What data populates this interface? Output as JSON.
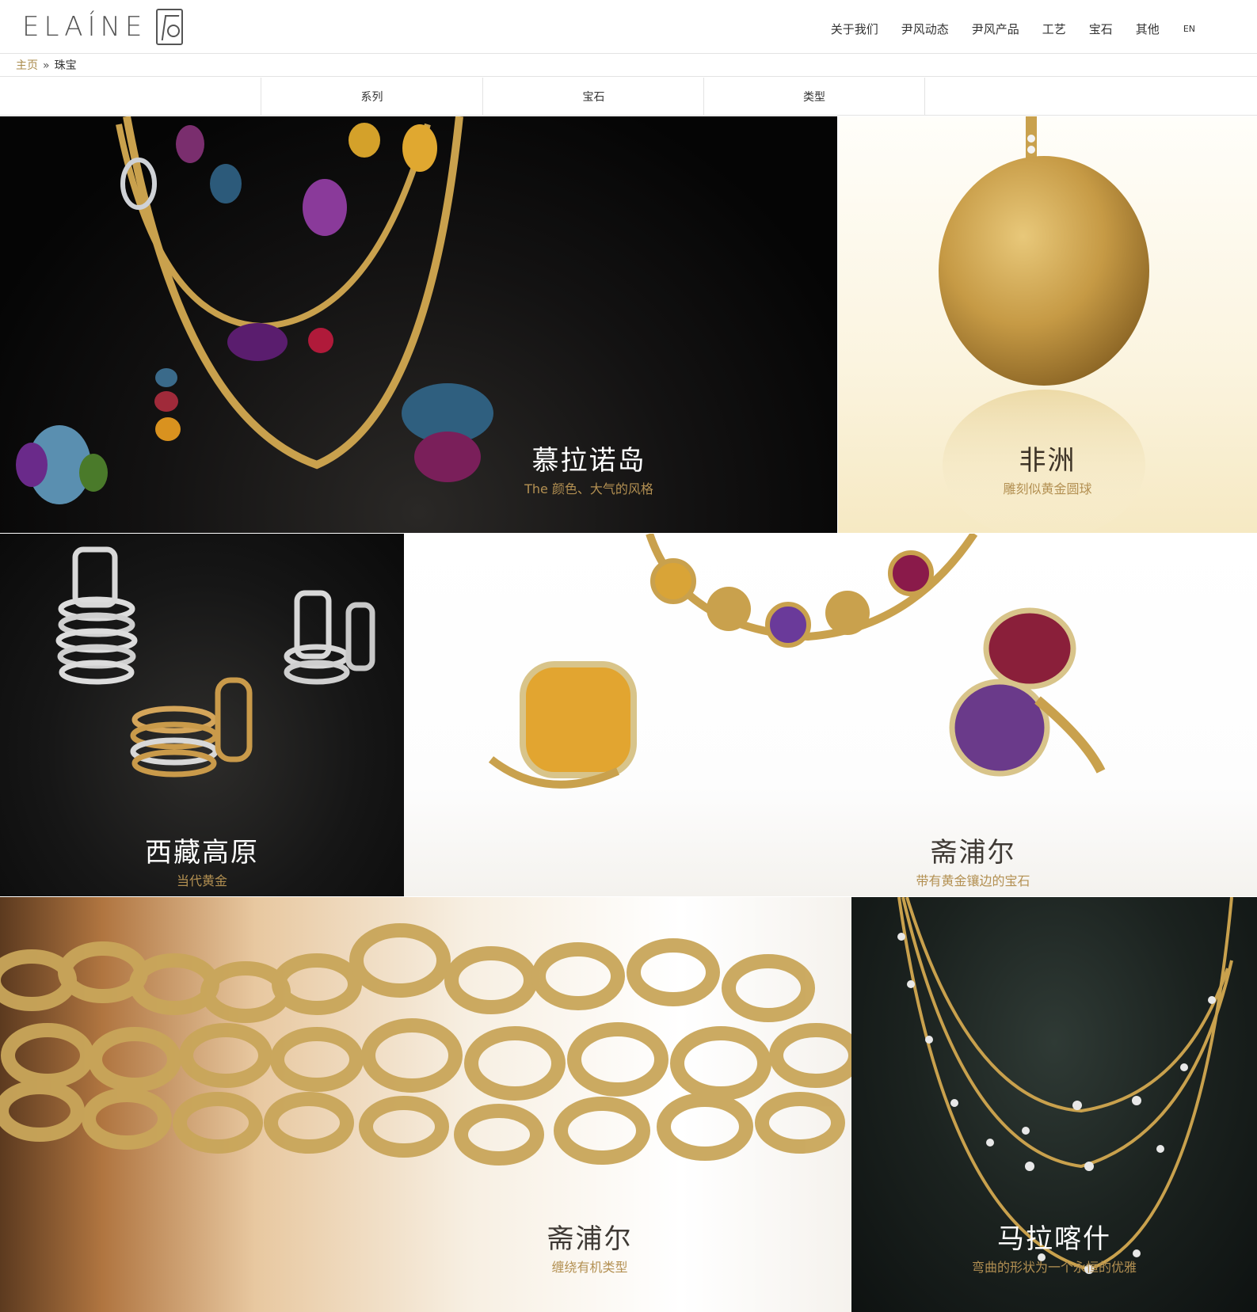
{
  "brand": {
    "logo_text": "ELAÍNE",
    "logo_seal_glyph": "尹"
  },
  "nav": {
    "items": [
      "关于我们",
      "尹风动态",
      "尹风产品",
      "工艺",
      "宝石",
      "其他"
    ],
    "lang": "EN"
  },
  "breadcrumb": {
    "home": "主页",
    "separator": "»",
    "current": "珠宝"
  },
  "filters": [
    "系列",
    "宝石",
    "类型"
  ],
  "tiles": [
    {
      "title": "慕拉诺岛",
      "subtitle": "The 颜色、大气的风格"
    },
    {
      "title": "非洲",
      "subtitle": "雕刻似黄金圆球"
    },
    {
      "title": "西藏高原",
      "subtitle": "当代黄金"
    },
    {
      "title": "斋浦尔",
      "subtitle": "带有黄金镶边的宝石"
    },
    {
      "title": "斋浦尔",
      "subtitle": "缠绕有机类型"
    },
    {
      "title": "马拉喀什",
      "subtitle": "弯曲的形状为一个永恒的优雅"
    }
  ],
  "colors": {
    "accent_gold": "#b39052",
    "breadcrumb_link": "#a98a4a",
    "divider": "#e3e3e3"
  }
}
